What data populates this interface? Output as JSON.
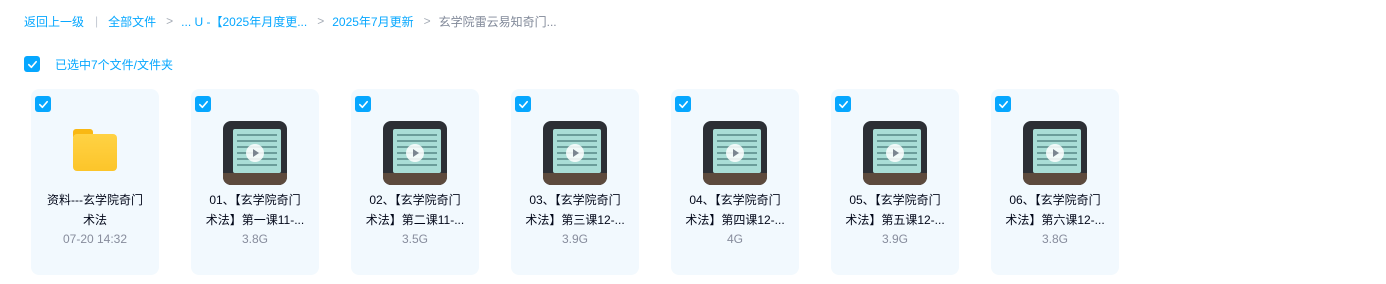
{
  "breadcrumb": {
    "back": "返回上一级",
    "all_files": "全部文件",
    "crumb_2": "... U -【2025年月度更...",
    "crumb_3": "2025年7月更新",
    "current": "玄学院雷云易知奇门..."
  },
  "selection": {
    "label": "已选中7个文件/文件夹",
    "checked": true
  },
  "items": [
    {
      "type": "folder",
      "name_line1": "资料---玄学院奇门",
      "name_line2": "术法",
      "meta": "07-20 14:32",
      "icon": "folder-icon"
    },
    {
      "type": "video",
      "name_line1": "01、【玄学院奇门",
      "name_line2": "术法】第一课11-...",
      "meta": "3.8G",
      "icon": "video-thumbnail"
    },
    {
      "type": "video",
      "name_line1": "02、【玄学院奇门",
      "name_line2": "术法】第二课11-...",
      "meta": "3.5G",
      "icon": "video-thumbnail"
    },
    {
      "type": "video",
      "name_line1": "03、【玄学院奇门",
      "name_line2": "术法】第三课12-...",
      "meta": "3.9G",
      "icon": "video-thumbnail"
    },
    {
      "type": "video",
      "name_line1": "04、【玄学院奇门",
      "name_line2": "术法】第四课12-...",
      "meta": "4G",
      "icon": "video-thumbnail"
    },
    {
      "type": "video",
      "name_line1": "05、【玄学院奇门",
      "name_line2": "术法】第五课12-...",
      "meta": "3.9G",
      "icon": "video-thumbnail"
    },
    {
      "type": "video",
      "name_line1": "06、【玄学院奇门",
      "name_line2": "术法】第六课12-...",
      "meta": "3.8G",
      "icon": "video-thumbnail"
    }
  ],
  "colors": {
    "accent": "#06a7ff",
    "card_bg": "#f2f9fe",
    "folder": "#fcc52a"
  }
}
